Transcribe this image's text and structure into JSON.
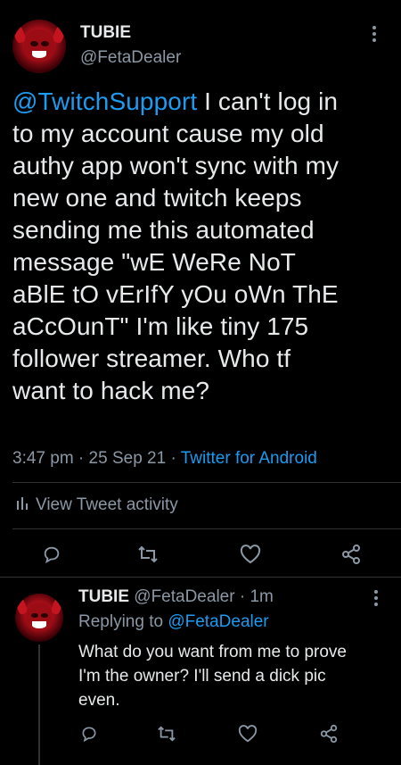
{
  "tweet": {
    "display_name": "TUBIE",
    "handle": "@FetaDealer",
    "mention": "@TwitchSupport",
    "body_lines": [
      "I can't log in",
      "to my account cause my old",
      "authy app won't sync with my",
      "new one and twitch keeps",
      "sending me this automated",
      "message \"wE WeRe NoT",
      "aBlE tO vErIfY yOu oWn ThE",
      "aCcOunT\" I'm like tiny 175",
      "follower streamer. Who tf",
      "want to hack me?"
    ],
    "time": "3:47 pm",
    "date": "25 Sep 21",
    "source": "Twitter for Android",
    "activity_label": "View Tweet activity"
  },
  "reply": {
    "display_name": "TUBIE",
    "handle": "@FetaDealer",
    "age": "1m",
    "replying_prefix": "Replying to",
    "replying_handle": "@FetaDealer",
    "body_lines": [
      "What do you want from me to prove",
      "I'm the owner? I'll send a dick pic",
      "even."
    ]
  },
  "icons": {
    "more": "more-vertical-icon",
    "activity": "bar-chart-icon",
    "reply": "reply-icon",
    "retweet": "retweet-icon",
    "like": "heart-icon",
    "share": "share-icon"
  },
  "colors": {
    "background": "#000000",
    "text": "#e7e9ea",
    "muted": "#8b98a5",
    "accent": "#1d9bf0",
    "divider": "#2f3336"
  }
}
